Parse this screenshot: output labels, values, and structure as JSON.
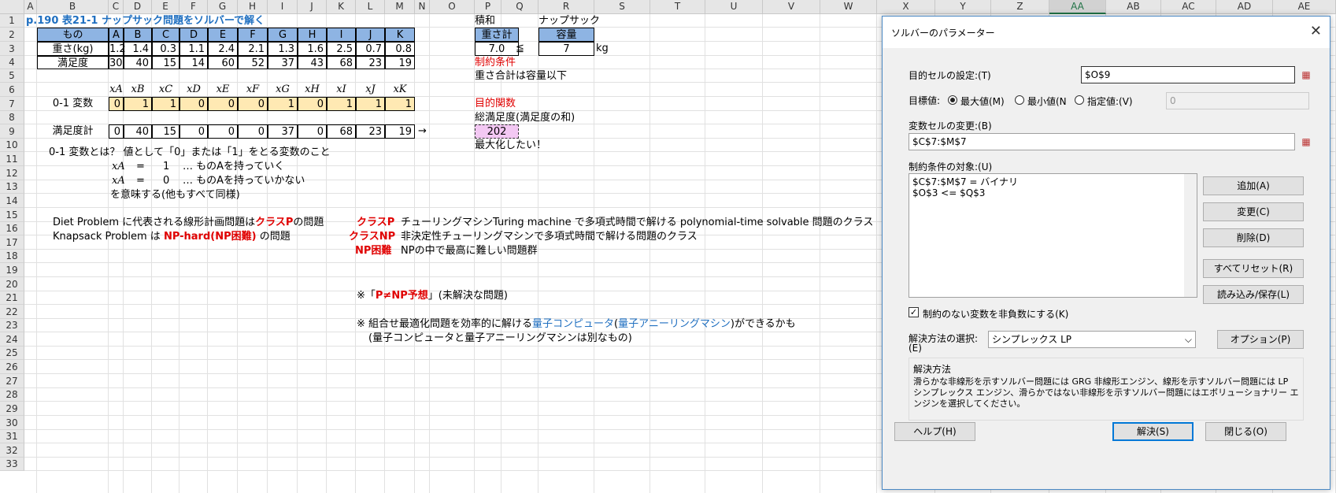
{
  "columns": [
    "A",
    "B",
    "C",
    "D",
    "E",
    "F",
    "G",
    "H",
    "I",
    "J",
    "K",
    "L",
    "M",
    "N",
    "O",
    "P",
    "Q",
    "R",
    "S",
    "T",
    "U",
    "V",
    "W",
    "X",
    "Y",
    "Z",
    "AA",
    "AB",
    "AC",
    "AD",
    "AE"
  ],
  "rows": [
    "1",
    "2",
    "3",
    "4",
    "5",
    "6",
    "7",
    "8",
    "9",
    "10",
    "11",
    "12",
    "13",
    "14",
    "15",
    "16",
    "17",
    "18",
    "19",
    "20",
    "21",
    "22",
    "23",
    "24",
    "25",
    "26",
    "27",
    "28",
    "29",
    "30",
    "31",
    "32",
    "33"
  ],
  "sheet": {
    "title": "p.190  表21-1  ナップサック問題をソルバーで解く",
    "items_header": "もの",
    "item_names": [
      "A",
      "B",
      "C",
      "D",
      "E",
      "F",
      "G",
      "H",
      "I",
      "J",
      "K"
    ],
    "weight_label": "重さ(kg)",
    "weights": [
      "1.2",
      "1.4",
      "0.3",
      "1.1",
      "2.4",
      "2.1",
      "1.3",
      "1.6",
      "2.5",
      "0.7",
      "0.8"
    ],
    "satisfaction_label": "満足度",
    "satisfaction": [
      "30",
      "40",
      "15",
      "14",
      "60",
      "52",
      "37",
      "43",
      "68",
      "23",
      "19"
    ],
    "var_names": [
      "xA",
      "xB",
      "xC",
      "xD",
      "xE",
      "xF",
      "xG",
      "xH",
      "xI",
      "xJ",
      "xK"
    ],
    "binary_label": "0-1 変数",
    "binary": [
      "0",
      "1",
      "1",
      "0",
      "0",
      "0",
      "1",
      "0",
      "1",
      "1",
      "1"
    ],
    "total_label": "満足度計",
    "totals": [
      "0",
      "40",
      "15",
      "0",
      "0",
      "0",
      "37",
      "0",
      "68",
      "23",
      "19"
    ],
    "arrow": "→",
    "sumprod": "積和",
    "knapsack": "ナップサック",
    "weight_total_label": "重さ計",
    "capacity_label": "容量",
    "weight_total": "7.0",
    "leq": "≦",
    "capacity": "7",
    "kg": "kg",
    "constraint_title": "制約条件",
    "constraint_text": "重さ合計は容量以下",
    "objective_title": "目的関数",
    "objective_text": "総満足度(満足度の和)",
    "objective_value": "202",
    "maximize": "最大化したい！",
    "r11": "0-1 変数とは？   値として「0」または「1」をとる変数のこと",
    "r12_var": "xA",
    "r12_eq": "=",
    "r12_val": "1",
    "r12_text": "… ものAを持っていく",
    "r13_var": "xA",
    "r13_eq": "=",
    "r13_val": "0",
    "r13_text": "… ものAを持っていかない",
    "r14": "を意味する(他もすべて同様)",
    "r16_a": "Diet Problem に代表される線形計画問題は",
    "r16_b": "クラスP",
    "r16_c": "の問題",
    "r16_cls": "クラスP",
    "r16_desc": "チューリングマシンTuring machine で多項式時間で解ける polynomial-time solvable 問題のクラス",
    "r17_a": "Knapsack Problem は",
    "r17_b": "NP-hard(NP困難)",
    "r17_c": "の問題",
    "r17_cls": "クラスNP",
    "r17_desc": "非決定性チューリングマシンで多項式時間で解ける問題のクラス",
    "r18_cls": "NP困難",
    "r18_desc": "NPの中で最高に難しい問題群",
    "r20_a": "※「",
    "r20_b": "P≠NP予想",
    "r20_c": "」(未解決な問題)",
    "r22_a": "※  組合せ最適化問題を効率的に解ける",
    "r22_b": "量子コンピュータ",
    "r22_c": "(",
    "r22_d": "量子アニーリングマシン",
    "r22_e": ")ができるかも",
    "r23": "(量子コンピュータと量子アニーリングマシンは別なもの)"
  },
  "dialog": {
    "title": "ソルバーのパラメーター",
    "close": "✕",
    "objective_label": "目的セルの設定:(T)",
    "objective_value": "$O$9",
    "target_label": "目標値:",
    "max_label": "最大値(M)",
    "min_label": "最小値(N",
    "value_label": "指定値:(V)",
    "value_field": "0",
    "vars_label": "変数セルの変更:(B)",
    "vars_value": "$C$7:$M$7",
    "constraints_label": "制約条件の対象:(U)",
    "constraints": [
      "$C$7:$M$7 = バイナリ",
      "$O$3 <= $Q$3"
    ],
    "add": "追加(A)",
    "change": "変更(C)",
    "delete": "削除(D)",
    "reset": "すべてリセット(R)",
    "load_save": "読み込み/保存(L)",
    "nonneg_check": "✓",
    "nonneg": "制約のない変数を非負数にする(K)",
    "method_label": "解決方法の選択:",
    "method_label2": "(E)",
    "method": "シンプレックス LP",
    "options": "オプション(P)",
    "solving_title": "解決方法",
    "solving_text": "滑らかな非線形を示すソルバー問題には GRG 非線形エンジン、線形を示すソルバー問題には LP シンプレックス エンジン、滑らかではない非線形を示すソルバー問題にはエボリューショナリー エンジンを選択してください。",
    "help": "ヘルプ(H)",
    "solve": "解決(S)",
    "closebtn": "閉じる(O)",
    "ref_icon": "▦",
    "dropdown_icon": "⌵"
  }
}
